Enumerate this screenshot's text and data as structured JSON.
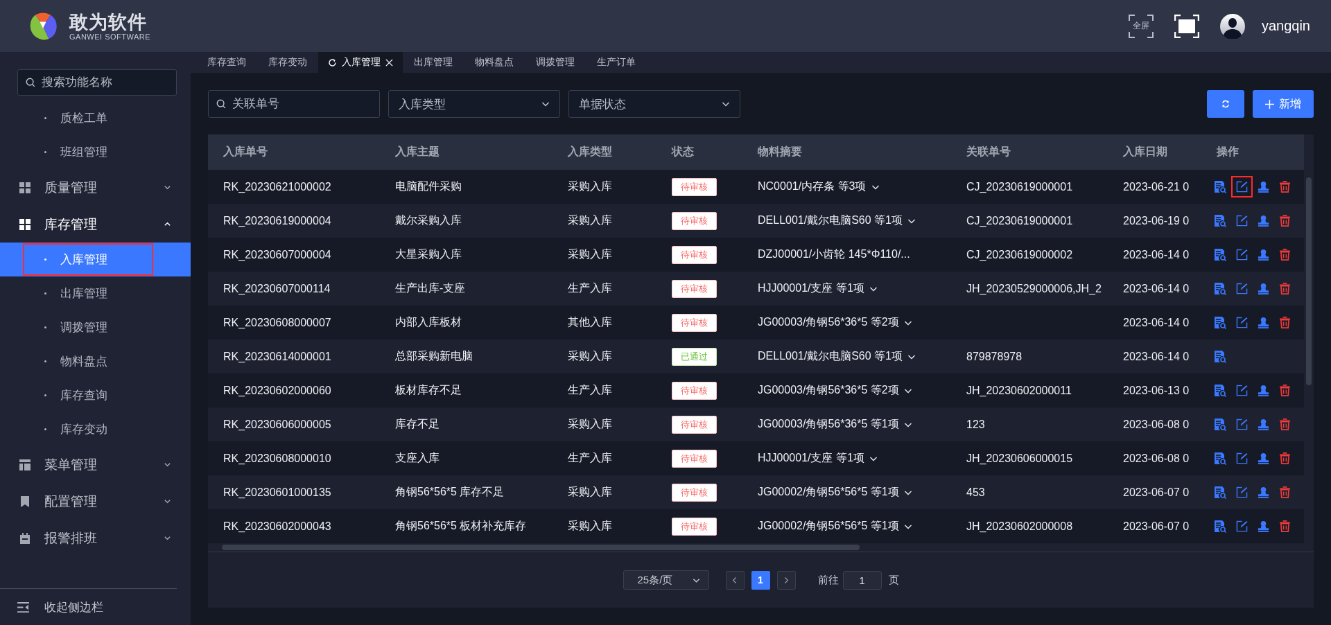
{
  "header": {
    "brand": "敢为软件",
    "brand_sub": "GANWEI SOFTWARE",
    "fullscreen_label": "全屏",
    "user": "yangqin"
  },
  "sidebar": {
    "search_placeholder": "搜索功能名称",
    "items": [
      {
        "children": [
          {
            "label": "质检工单",
            "selected": false,
            "highlighted": false
          },
          {
            "label": "班组管理",
            "selected": false,
            "highlighted": false
          }
        ]
      },
      {
        "label": "质量管理",
        "expanded": false
      },
      {
        "label": "库存管理",
        "expanded": true,
        "children": [
          {
            "label": "入库管理",
            "selected": true,
            "highlighted": true
          },
          {
            "label": "出库管理",
            "selected": false,
            "highlighted": false
          },
          {
            "label": "调拨管理",
            "selected": false,
            "highlighted": false
          },
          {
            "label": "物料盘点",
            "selected": false,
            "highlighted": false
          },
          {
            "label": "库存查询",
            "selected": false,
            "highlighted": false
          },
          {
            "label": "库存变动",
            "selected": false,
            "highlighted": false
          }
        ]
      },
      {
        "label": "菜单管理",
        "expanded": false
      },
      {
        "label": "配置管理",
        "expanded": false
      },
      {
        "label": "报警排班",
        "expanded": false
      }
    ],
    "collapse_label": "收起侧边栏"
  },
  "tabs": [
    {
      "label": "库存查询",
      "selected": false
    },
    {
      "label": "库存变动",
      "selected": false
    },
    {
      "label": "入库管理",
      "selected": true
    },
    {
      "label": "出库管理",
      "selected": false
    },
    {
      "label": "物料盘点",
      "selected": false
    },
    {
      "label": "调拨管理",
      "selected": false
    },
    {
      "label": "生产订单",
      "selected": false
    }
  ],
  "filters": {
    "search_placeholder": "关联单号",
    "selects": [
      {
        "placeholder": "入库类型"
      },
      {
        "placeholder": "单据状态"
      }
    ],
    "add_button": "新增"
  },
  "table": {
    "columns": [
      "入库单号",
      "入库主题",
      "入库类型",
      "状态",
      "物料摘要",
      "关联单号",
      "入库日期",
      "操作"
    ],
    "rows": [
      {
        "id": "RK_20230621000002",
        "subject": "电脑配件采购",
        "type": "采购入库",
        "status": {
          "label": "待审核",
          "kind": "pending"
        },
        "materials": "NC0001/内存条 等3项",
        "expandable": true,
        "related": "CJ_20230619000001",
        "date": "2023-06-21 0",
        "actions": [
          {
            "kind": "view"
          },
          {
            "kind": "edit",
            "highlighted": true
          },
          {
            "kind": "assign"
          },
          {
            "kind": "delete"
          }
        ]
      },
      {
        "id": "RK_20230619000004",
        "subject": "戴尔采购入库",
        "type": "采购入库",
        "status": {
          "label": "待审核",
          "kind": "pending"
        },
        "materials": "DELL001/戴尔电脑S60 等1项",
        "expandable": true,
        "related": "CJ_20230619000001",
        "date": "2023-06-19 0",
        "actions": [
          {
            "kind": "view"
          },
          {
            "kind": "edit",
            "highlighted": false
          },
          {
            "kind": "assign"
          },
          {
            "kind": "delete"
          }
        ]
      },
      {
        "id": "RK_20230607000004",
        "subject": "大星采购入库",
        "type": "采购入库",
        "status": {
          "label": "待审核",
          "kind": "pending"
        },
        "materials": "DZJ00001/小齿轮 145*Φ110/...",
        "expandable": false,
        "related": "CJ_20230619000002",
        "date": "2023-06-14 0",
        "actions": [
          {
            "kind": "view"
          },
          {
            "kind": "edit",
            "highlighted": false
          },
          {
            "kind": "assign"
          },
          {
            "kind": "delete"
          }
        ]
      },
      {
        "id": "RK_20230607000114",
        "subject": "生产出库-支座",
        "type": "生产入库",
        "status": {
          "label": "待审核",
          "kind": "pending"
        },
        "materials": "HJJ00001/支座 等1项",
        "expandable": true,
        "related": "JH_20230529000006,JH_2",
        "date": "2023-06-14 0",
        "actions": [
          {
            "kind": "view"
          },
          {
            "kind": "edit",
            "highlighted": false
          },
          {
            "kind": "assign"
          },
          {
            "kind": "delete"
          }
        ]
      },
      {
        "id": "RK_20230608000007",
        "subject": "内部入库板材",
        "type": "其他入库",
        "status": {
          "label": "待审核",
          "kind": "pending"
        },
        "materials": "JG00003/角钢56*36*5 等2项",
        "expandable": true,
        "date": "2023-06-14 0",
        "actions": [
          {
            "kind": "view"
          },
          {
            "kind": "edit",
            "highlighted": false
          },
          {
            "kind": "assign"
          },
          {
            "kind": "delete"
          }
        ]
      },
      {
        "id": "RK_20230614000001",
        "subject": "总部采购新电脑",
        "type": "采购入库",
        "status": {
          "label": "已通过",
          "kind": "approved"
        },
        "materials": "DELL001/戴尔电脑S60 等1项",
        "expandable": true,
        "related": "879878978",
        "date": "2023-06-14 0",
        "actions": [
          {
            "kind": "view"
          }
        ]
      },
      {
        "id": "RK_20230602000060",
        "subject": "板材库存不足",
        "type": "生产入库",
        "status": {
          "label": "待审核",
          "kind": "pending"
        },
        "materials": "JG00003/角钢56*36*5 等2项",
        "expandable": true,
        "related": "JH_20230602000011",
        "date": "2023-06-13 0",
        "actions": [
          {
            "kind": "view"
          },
          {
            "kind": "edit",
            "highlighted": false
          },
          {
            "kind": "assign"
          },
          {
            "kind": "delete"
          }
        ]
      },
      {
        "id": "RK_20230606000005",
        "subject": "库存不足",
        "type": "采购入库",
        "status": {
          "label": "待审核",
          "kind": "pending"
        },
        "materials": "JG00003/角钢56*36*5 等1项",
        "expandable": true,
        "related": "123",
        "date": "2023-06-08 0",
        "actions": [
          {
            "kind": "view"
          },
          {
            "kind": "edit",
            "highlighted": false
          },
          {
            "kind": "assign"
          },
          {
            "kind": "delete"
          }
        ]
      },
      {
        "id": "RK_20230608000010",
        "subject": "支座入库",
        "type": "生产入库",
        "status": {
          "label": "待审核",
          "kind": "pending"
        },
        "materials": "HJJ00001/支座 等1项",
        "expandable": true,
        "related": "JH_20230606000015",
        "date": "2023-06-08 0",
        "actions": [
          {
            "kind": "view"
          },
          {
            "kind": "edit",
            "highlighted": false
          },
          {
            "kind": "assign"
          },
          {
            "kind": "delete"
          }
        ]
      },
      {
        "id": "RK_20230601000135",
        "subject": "角钢56*56*5 库存不足",
        "type": "采购入库",
        "status": {
          "label": "待审核",
          "kind": "pending"
        },
        "materials": "JG00002/角钢56*56*5 等1项",
        "expandable": true,
        "related": "453",
        "date": "2023-06-07 0",
        "actions": [
          {
            "kind": "view"
          },
          {
            "kind": "edit",
            "highlighted": false
          },
          {
            "kind": "assign"
          },
          {
            "kind": "delete"
          }
        ]
      },
      {
        "id": "RK_20230602000043",
        "subject": "角钢56*56*5 板材补充库存",
        "type": "采购入库",
        "status": {
          "label": "待审核",
          "kind": "pending"
        },
        "materials": "JG00002/角钢56*56*5 等1项",
        "expandable": true,
        "related": "JH_20230602000008",
        "date": "2023-06-07 0",
        "actions": [
          {
            "kind": "view"
          },
          {
            "kind": "edit",
            "highlighted": false
          },
          {
            "kind": "assign"
          },
          {
            "kind": "delete"
          }
        ]
      }
    ]
  },
  "pagination": {
    "page_size": "25条/页",
    "pages": [
      {
        "label": "1",
        "selected": true
      }
    ],
    "goto_label": "前往",
    "goto_value": "1",
    "page_suffix": "页"
  }
}
